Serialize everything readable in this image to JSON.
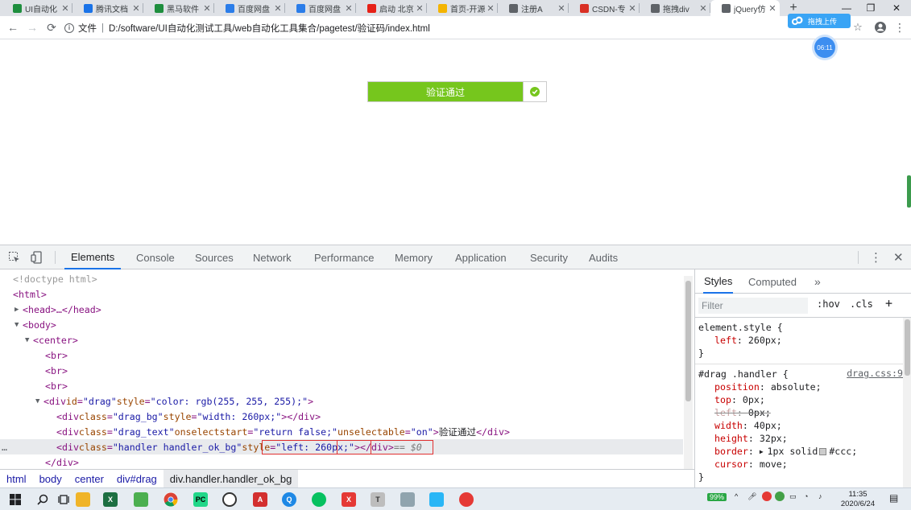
{
  "tabs": [
    {
      "label": "UI自动化",
      "icon": "sheet-icon",
      "color": "#1e8e3e"
    },
    {
      "label": "腾讯文档",
      "icon": "tencent-docs-icon",
      "color": "#1a73e8"
    },
    {
      "label": "黑马软件",
      "icon": "sheet-icon",
      "color": "#1e8e3e"
    },
    {
      "label": "百度网盘",
      "icon": "baidu-netdisk-icon",
      "color": "#2b7de9"
    },
    {
      "label": "百度网盘",
      "icon": "baidu-netdisk-icon",
      "color": "#2b7de9"
    },
    {
      "label": "启动 北京",
      "icon": "youtube-icon",
      "color": "#e62117"
    },
    {
      "label": "首页-开源",
      "icon": "colorful-icon",
      "color": "#f4b400"
    },
    {
      "label": "注册A",
      "icon": "globe-icon",
      "color": "#5f6368"
    },
    {
      "label": "CSDN-专",
      "icon": "csdn-icon",
      "color": "#d93025"
    },
    {
      "label": "拖拽div",
      "icon": "globe-icon",
      "color": "#5f6368"
    },
    {
      "label": "jQuery仿",
      "icon": "globe-icon",
      "color": "#5f6368",
      "active": true
    }
  ],
  "window": {
    "minimize": "—",
    "restore": "❐",
    "close": "✕",
    "new_tab": "+"
  },
  "address": {
    "prefix": "文件",
    "separator": "|",
    "url": "D:/software/UI自动化测试工具/web自动化工具集合/pagetest/验证码/index.html"
  },
  "overlay": {
    "upload_label": "拖拽上传",
    "timer": "06:11"
  },
  "page": {
    "drag_text": "验证通过",
    "progress": 0.86,
    "colors": {
      "success": "#76c61d",
      "border": "#cccccc"
    }
  },
  "devtools": {
    "tabs": [
      "Elements",
      "Console",
      "Sources",
      "Network",
      "Performance",
      "Memory",
      "Application",
      "Security",
      "Audits"
    ],
    "active_tab": "Elements",
    "dom": {
      "doctype": "<!doctype html>",
      "html": "<html>",
      "head": "<head>…</head>",
      "body": "<body>",
      "center": "<center>",
      "br": "<br>",
      "drag_open": "<div",
      "drag_id_attr": "id",
      "drag_id_val": "\"drag\"",
      "drag_style_attr": "style",
      "drag_style_val": "\"color: rgb(255, 255, 255);\"",
      "bg_class_val": "\"drag_bg\"",
      "bg_style_val": "\"width: 260px;\"",
      "text_class_val": "\"drag_text\"",
      "text_onselect_attr": "onselectstart",
      "text_onselect_val": "\"return false;\"",
      "text_unsel_attr": "unselectable",
      "text_unsel_val": "\"on\"",
      "text_content": "验证通过",
      "handler_class_val": "\"handler handler_ok_bg\"",
      "handler_style_val_a": "\"left: ",
      "handler_style_val_b": "260px",
      "handler_style_val_c": ";\"",
      "selected_marker": "== $0",
      "div_close": "</div>",
      "class_attr": "class",
      "dots": "…"
    },
    "breadcrumbs": [
      "html",
      "body",
      "center",
      "div#drag",
      "div.handler.handler_ok_bg"
    ],
    "styles_tabs": [
      "Styles",
      "Computed",
      "»"
    ],
    "filter_placeholder": "Filter",
    "hov": ":hov",
    "cls": ".cls",
    "plus": "+",
    "element_style": {
      "selector": "element.style {",
      "prop": "left",
      "value": "260px;",
      "close": "}"
    },
    "rule": {
      "selector": "#drag .handler {",
      "source": "drag.css:9",
      "props": [
        {
          "name": "position",
          "value": "absolute;"
        },
        {
          "name": "top",
          "value": "0px;"
        },
        {
          "name": "left",
          "value": "0px;",
          "overridden": true
        },
        {
          "name": "width",
          "value": "40px;"
        },
        {
          "name": "height",
          "value": "32px;"
        },
        {
          "name": "border",
          "value": "1px solid",
          "swatch": "#ccc;"
        },
        {
          "name": "cursor",
          "value": "move;"
        }
      ],
      "close": "}"
    }
  },
  "taskbar": {
    "battery": "99%",
    "time": "11:35",
    "date": "2020/6/24"
  }
}
